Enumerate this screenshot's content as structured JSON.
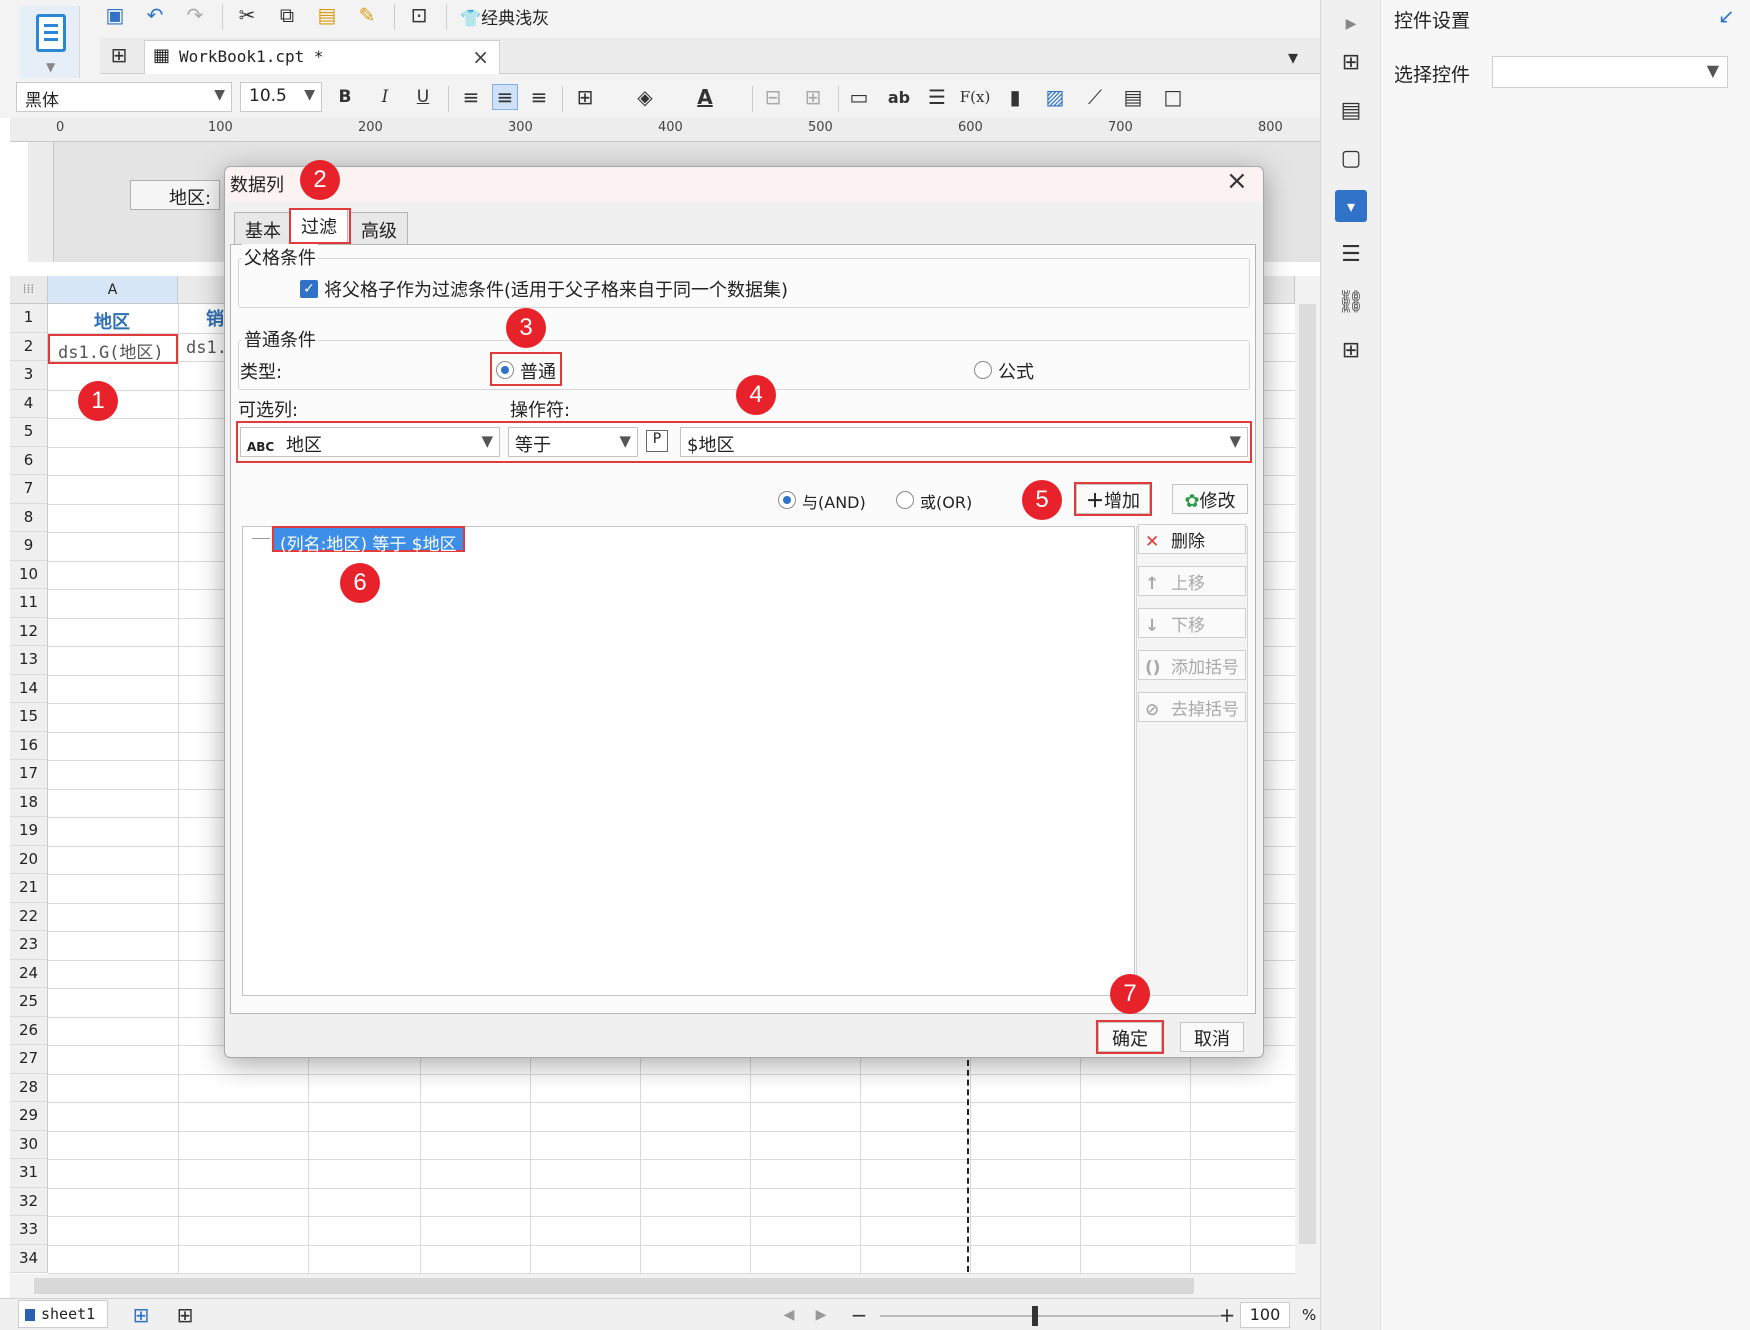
{
  "toolbar": {
    "template_style": "经典浅灰",
    "font_name": "黑体",
    "font_size": "10.5",
    "bold": "B",
    "italic": "I",
    "underline": "U",
    "text_ab": "ab",
    "formula": "F(x)"
  },
  "tabs": {
    "workbook": "WorkBook1.cpt *",
    "close": "×"
  },
  "ruler": [
    "0",
    "100",
    "200",
    "300",
    "400",
    "500",
    "600",
    "700",
    "800"
  ],
  "design": {
    "param_label": "地区:"
  },
  "grid": {
    "col_a": "A",
    "rows": [
      "1",
      "2",
      "3",
      "4",
      "5",
      "6",
      "7",
      "8",
      "9",
      "10",
      "11",
      "12",
      "13",
      "14",
      "15",
      "16",
      "17",
      "18",
      "19",
      "20",
      "21",
      "22",
      "23",
      "24",
      "25",
      "26",
      "27",
      "28",
      "29",
      "30",
      "31",
      "32",
      "33",
      "34"
    ],
    "a1": "地区",
    "a2": "ds1.G(地区)",
    "b1": "销",
    "b2": "ds1."
  },
  "status": {
    "sheet": "sheet1",
    "zoom_minus": "−",
    "zoom_plus": "+",
    "zoom_value": "100",
    "zoom_unit": "%"
  },
  "right_panel": {
    "title": "控件设置",
    "select_label": "选择控件",
    "select_value": ""
  },
  "dialog": {
    "title": "数据列",
    "close": "×",
    "tabs": [
      "基本",
      "过滤",
      "高级"
    ],
    "parent_group": "父格条件",
    "parent_checkbox": "将父格子作为过滤条件(适用于父子格来自于同一个数据集)",
    "normal_group": "普通条件",
    "type_label": "类型:",
    "type_normal": "普通",
    "type_formula": "公式",
    "column_label": "可选列:",
    "operator_label": "操作符:",
    "column_value": "地区",
    "operator_value": "等于",
    "param_value": "$地区",
    "and_label": "与(AND)",
    "or_label": "或(OR)",
    "add_button": "增加",
    "modify_button": "修改",
    "condition_item": "(列名:地区) 等于 $地区",
    "delete_button": "删除",
    "move_up": "上移",
    "move_down": "下移",
    "add_bracket": "添加括号",
    "remove_bracket": "去掉括号",
    "ok": "确定",
    "cancel": "取消"
  },
  "markers": [
    "1",
    "2",
    "3",
    "4",
    "5",
    "6",
    "7"
  ],
  "colors": {
    "accent": "#2f72c7",
    "highlight_red": "#e03a3a",
    "marker_red": "#e8222a",
    "selection_blue": "#3c8ee6"
  }
}
